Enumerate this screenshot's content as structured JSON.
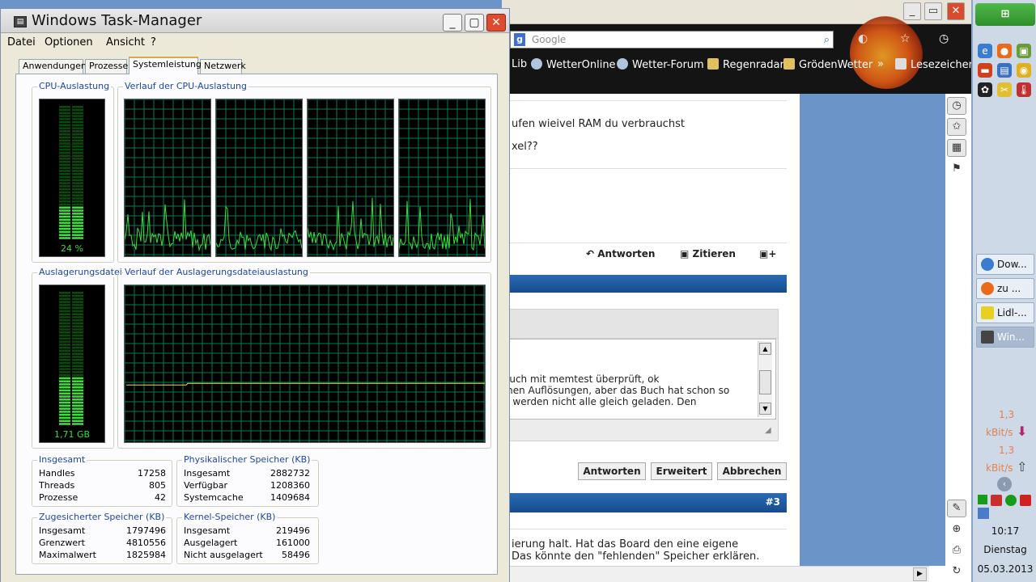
{
  "browser": {
    "search_placeholder": "Google",
    "bookmarks": [
      "Lib",
      "WetterOnline",
      "Wetter-Forum",
      "Regenradar",
      "GrödenWetter",
      "»",
      "Lesezeichen"
    ],
    "post_lines": [
      "ufen wieivel RAM du verbrauchst",
      "xel??"
    ],
    "reply_buttons": {
      "antworten": "Antworten",
      "zitieren": "Zitieren"
    },
    "editor_lines": [
      "auch mit memtest überprüft, ok",
      "men Auflösungen, aber das Buch hat schon so",
      "n werden nicht alle gleich geladen. Den"
    ],
    "form_buttons": [
      "Antworten",
      "Erweitert",
      "Abbrechen"
    ],
    "post_number": "#3",
    "post3_lines": [
      "ierung halt. Hat das Board den eine eigene",
      "Das könnte den \"fehlenden\" Speicher erklären."
    ]
  },
  "taskbar": {
    "tasks": [
      {
        "label": "Dow...",
        "icon": "ie-icon"
      },
      {
        "label": "zu ...",
        "icon": "firefox-icon"
      },
      {
        "label": "Lidl-...",
        "icon": "lidl-icon"
      },
      {
        "label": "Win...",
        "icon": "taskmanager-icon"
      }
    ],
    "net_down": "1,3",
    "net_down_unit": "kBit/s",
    "net_up": "1,3",
    "net_up_unit": "kBit/s",
    "time": "10:17",
    "day": "Dienstag",
    "date": "05.03.2013"
  },
  "taskmanager": {
    "title": "Windows Task-Manager",
    "menu": [
      "Datei",
      "Optionen",
      "Ansicht",
      "?"
    ],
    "tabs": [
      "Anwendungen",
      "Prozesse",
      "Systemleistung",
      "Netzwerk"
    ],
    "selected_tab": "Systemleistung",
    "cpu_label": "CPU-Auslastung",
    "cpu_history_label": "Verlauf der CPU-Auslastung",
    "cpu_value": "24 %",
    "cpu_fraction": 0.24,
    "page_label": "Auslagerungsdatei",
    "page_history_label": "Verlauf der Auslagerungsdateiauslastung",
    "page_value": "1,71 GB",
    "page_fraction": 0.37,
    "totals": {
      "title": "Insgesamt",
      "rows": [
        {
          "label": "Handles",
          "value": "17258"
        },
        {
          "label": "Threads",
          "value": "805"
        },
        {
          "label": "Prozesse",
          "value": "42"
        }
      ]
    },
    "physical": {
      "title": "Physikalischer Speicher (KB)",
      "rows": [
        {
          "label": "Insgesamt",
          "value": "2882732"
        },
        {
          "label": "Verfügbar",
          "value": "1208360"
        },
        {
          "label": "Systemcache",
          "value": "1409684"
        }
      ]
    },
    "commit": {
      "title": "Zugesicherter Speicher (KB)",
      "rows": [
        {
          "label": "Insgesamt",
          "value": "1797496"
        },
        {
          "label": "Grenzwert",
          "value": "4810556"
        },
        {
          "label": "Maximalwert",
          "value": "1825984"
        }
      ]
    },
    "kernel": {
      "title": "Kernel-Speicher (KB)",
      "rows": [
        {
          "label": "Insgesamt",
          "value": "219496"
        },
        {
          "label": "Ausgelagert",
          "value": "161000"
        },
        {
          "label": "Nicht ausgelagert",
          "value": "58496"
        }
      ]
    }
  },
  "colors": {
    "graph_green": "#3cdc3c",
    "grid": "#0a7a52",
    "page_line": "#e8e838"
  }
}
